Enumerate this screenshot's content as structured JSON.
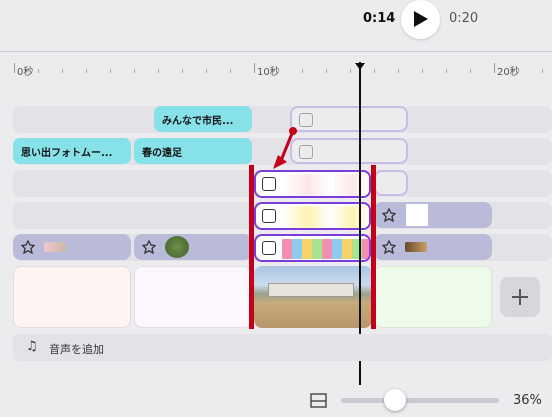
{
  "player": {
    "current_time": "0:14",
    "total_time": "0:20"
  },
  "ruler": {
    "labels": [
      "0秒",
      "10秒",
      "20秒"
    ]
  },
  "tracks": {
    "text_clip_1": "みんなで市民...",
    "text_clip_2": "思い出フォトムー...",
    "text_clip_3": "春の遠足"
  },
  "audio": {
    "add_label": "音声を追加"
  },
  "zoom": {
    "value_label": "36%",
    "level": 0.36
  },
  "colors": {
    "accent_purple": "#7a3ddc",
    "teal": "#86e1e9",
    "marker_red": "#c4001a"
  }
}
